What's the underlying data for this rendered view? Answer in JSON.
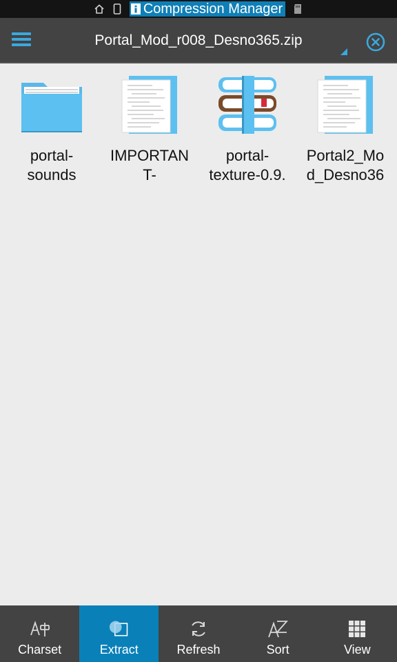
{
  "status_bar": {
    "app_chip_label": "Compression Manager",
    "icons": [
      "home-outline-icon",
      "phone-icon",
      "info-icon",
      "sd-card-icon"
    ]
  },
  "title_bar": {
    "title": "Portal_Mod_r008_Desno365.zip",
    "menu_icon": "hamburger-menu-icon",
    "close_icon": "close-circle-icon"
  },
  "files": [
    {
      "label_line1": "portal-",
      "label_line2": "sounds",
      "icon": "folder-icon"
    },
    {
      "label_line1": "IMPORTAN",
      "label_line2": "T-",
      "icon": "text-document-icon"
    },
    {
      "label_line1": "portal-",
      "label_line2": "texture-0.9.",
      "icon": "books-archive-icon"
    },
    {
      "label_line1": "Portal2_Mo",
      "label_line2": "d_Desno36",
      "icon": "text-document-icon"
    }
  ],
  "bottom_bar": {
    "charset": "Charset",
    "extract": "Extract",
    "refresh": "Refresh",
    "sort": "Sort",
    "view": "View",
    "active": "Extract"
  },
  "colors": {
    "accent": "#0a80b8",
    "accent_light": "#3aa9e0",
    "bar_bg": "#434343",
    "background": "#ececec"
  }
}
